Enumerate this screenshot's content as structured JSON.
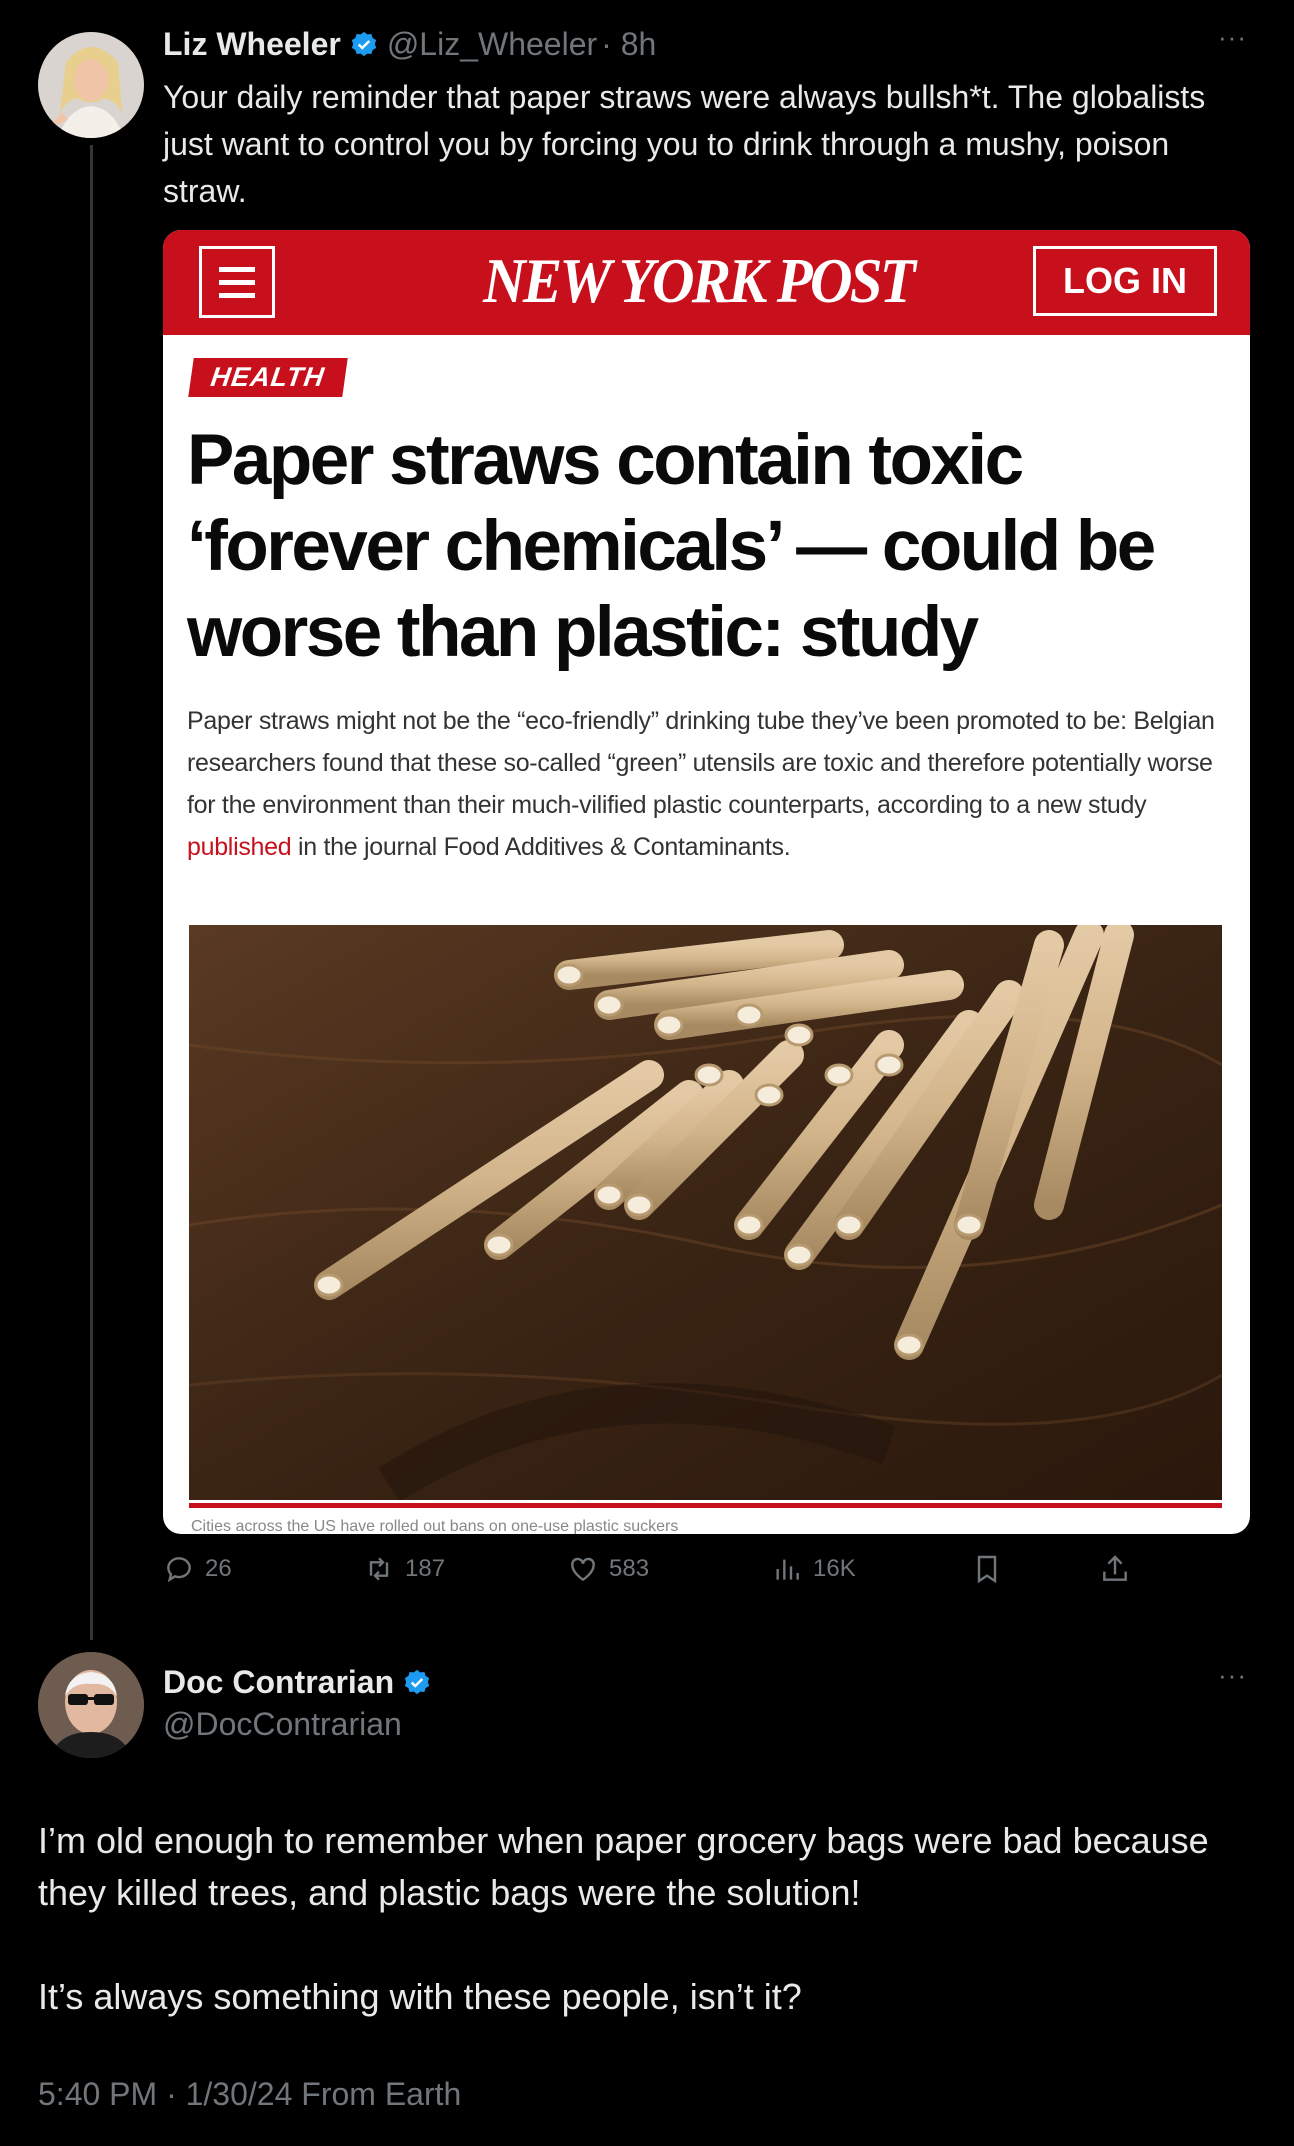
{
  "tweet1": {
    "name": "Liz Wheeler",
    "handle": "@Liz_Wheeler",
    "time": "· 8h",
    "text": "Your daily reminder that paper straws were always bullsh*t. The globalists just want to control you by forcing you to drink through a mushy, poison straw.",
    "card": {
      "brand": "NEW YORK POST",
      "login_label": "LOG IN",
      "section": "HEALTH",
      "headline": "Paper straws contain toxic ‘forever chemicals’ — could be worse than plastic: study",
      "summary_before": "Paper straws might not be the “eco-friendly” drinking tube they’ve been promoted to be: Belgian researchers found that these so-called “green” utensils are toxic and therefore potentially worse for the environment than their much-vilified plastic counterparts, according to a new study ",
      "summary_link": "published",
      "summary_after": " in the journal Food Additives & Contaminants.",
      "caption": "Cities across the US have rolled out bans on one-use plastic suckers"
    },
    "stats": {
      "replies": "26",
      "retweets": "187",
      "likes": "583",
      "views": "16K"
    }
  },
  "tweet2": {
    "name": "Doc Contrarian",
    "handle": "@DocContrarian",
    "paragraphs": [
      "I’m old enough to remember when paper grocery bags were bad because they killed trees, and plastic bags were the solution!",
      "It’s always something with these people, isn’t it?"
    ],
    "timestamp": "5:40 PM · 1/30/24 From Earth"
  },
  "colors": {
    "background": "#000000",
    "text": "#e7e9ea",
    "muted": "#71767b",
    "verified": "#1d9bf0",
    "nyp_red": "#c8101d"
  }
}
